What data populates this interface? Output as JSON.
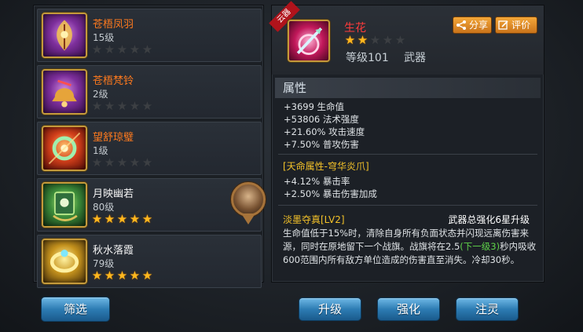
{
  "items": [
    {
      "name": "苍梧凤羽",
      "level": "15级",
      "stars": [
        0,
        0,
        0,
        0,
        0
      ],
      "color": "#ff7a1e",
      "icon": "phoenix-feather-icon",
      "frame": "purple"
    },
    {
      "name": "苍梧梵铃",
      "level": "2级",
      "stars": [
        0,
        0,
        0,
        0,
        0
      ],
      "color": "#ff7a1e",
      "icon": "bell-icon",
      "frame": "purple"
    },
    {
      "name": "望舒琼璧",
      "level": "1级",
      "stars": [
        0,
        0,
        0,
        0,
        0
      ],
      "color": "#ff7a1e",
      "icon": "jade-disc-icon",
      "frame": "red"
    },
    {
      "name": "月映幽若",
      "level": "80级",
      "stars": [
        1,
        1,
        1,
        1,
        1
      ],
      "color": "#f4f4f4",
      "icon": "jade-scroll-icon",
      "frame": "green",
      "equipped": true
    },
    {
      "name": "秋水落霞",
      "level": "79级",
      "stars": [
        1,
        1,
        1,
        1,
        1
      ],
      "color": "#f4f4f4",
      "icon": "gold-ring-icon",
      "frame": "gold"
    }
  ],
  "filter_label": "筛选",
  "detail": {
    "tag": "云器",
    "name": "生花",
    "stars": [
      1,
      1,
      0,
      0,
      0
    ],
    "level": "等级101",
    "type": "武器",
    "share_label": "分享",
    "rate_label": "评价",
    "attributes_title": "属性",
    "attributes": [
      "+3699 生命值",
      "+53806 法术强度",
      "+21.60% 攻击速度",
      "+7.50% 普攻伤害"
    ],
    "sky_title": "[天命属性-穹华炎爪]",
    "sky_attributes": [
      "+4.12% 暴击率",
      "+2.50% 暴击伤害加成"
    ],
    "skill_title": "淡墨夺真[LV2]",
    "skill_upgrade_note": "武器总强化6星升级",
    "skill_desc_1": "生命值低于15%时，清除自身所有负面状态并闪现远离伤害来源，同时在原地留下一个战旗。战旗将在2.5",
    "skill_desc_green": "(下一级3)",
    "skill_desc_2": "秒内吸收600范围内所有敌方单位造成的伤害直至消失。冷却30秒。"
  },
  "actions": {
    "upgrade": "升级",
    "enhance": "强化",
    "spirit": "注灵"
  },
  "colors": {
    "orange_name": "#ff7a1e",
    "red_name": "#ff3b3b",
    "gold_text": "#f4c229",
    "green_text": "#5fd34a",
    "button_blue": "#2d7cb3",
    "button_orange": "#e08a25"
  }
}
